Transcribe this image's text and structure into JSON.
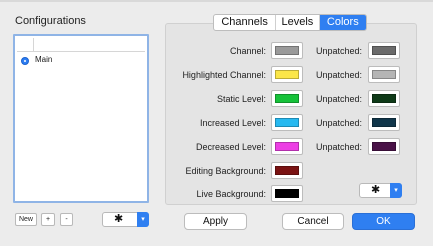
{
  "configurations": {
    "title": "Configurations",
    "items": [
      {
        "label": "Main",
        "selected": true
      }
    ],
    "buttons": {
      "new": "New",
      "add": "+",
      "remove": "-"
    }
  },
  "tabs": [
    {
      "label": "Channels",
      "active": false
    },
    {
      "label": "Levels",
      "active": false
    },
    {
      "label": "Colors",
      "active": true
    }
  ],
  "colors": {
    "rows": [
      {
        "label": "Channel:",
        "color": "#9a9a9a",
        "unpatched_label": "Unpatched:",
        "unpatched_color": "#6b6b6b"
      },
      {
        "label": "Highlighted Channel:",
        "color": "#fbe648",
        "unpatched_label": "Unpatched:",
        "unpatched_color": "#b5b5b5"
      },
      {
        "label": "Static Level:",
        "color": "#16c23a",
        "unpatched_label": "Unpatched:",
        "unpatched_color": "#0f3a18"
      },
      {
        "label": "Increased Level:",
        "color": "#27b9f0",
        "unpatched_label": "Unpatched:",
        "unpatched_color": "#10364a"
      },
      {
        "label": "Decreased Level:",
        "color": "#ec3fe4",
        "unpatched_label": "Unpatched:",
        "unpatched_color": "#4a1248"
      }
    ],
    "editing_background": {
      "label": "Editing Background:",
      "color": "#7a1212"
    },
    "live_background": {
      "label": "Live Background:",
      "color": "#000000"
    }
  },
  "accent_color": "#2f7ff1",
  "footer": {
    "apply": "Apply",
    "cancel": "Cancel",
    "ok": "OK"
  },
  "icons": {
    "gear": "gear-icon",
    "chevron": "chevron-down-icon"
  }
}
